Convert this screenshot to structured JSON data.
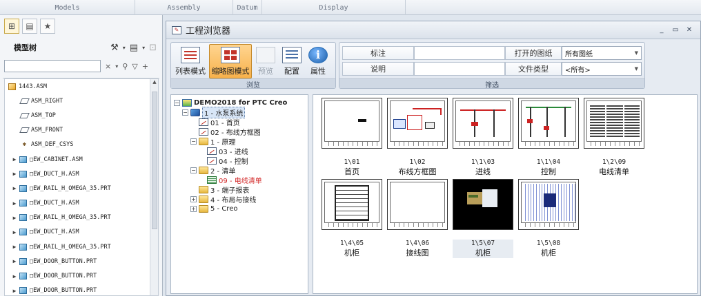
{
  "top_ribbon": {
    "groups": [
      "Models",
      "Assembly",
      "Datum",
      "Display"
    ]
  },
  "left_panel": {
    "title": "模型树",
    "search_value": "",
    "tree": [
      {
        "label": "1443.ASM",
        "type": "root"
      },
      {
        "label": "ASM_RIGHT",
        "type": "plane"
      },
      {
        "label": "ASM_TOP",
        "type": "plane"
      },
      {
        "label": "ASM_FRONT",
        "type": "plane"
      },
      {
        "label": "ASM_DEF_CSYS",
        "type": "csys"
      },
      {
        "label": "□EW_CABINET.ASM",
        "type": "part"
      },
      {
        "label": "□EW_DUCT_H.ASM",
        "type": "part"
      },
      {
        "label": "□EW_RAIL_H_OMEGA_35.PRT",
        "type": "part"
      },
      {
        "label": "□EW_DUCT_H.ASM",
        "type": "part"
      },
      {
        "label": "□EW_RAIL_H_OMEGA_35.PRT",
        "type": "part"
      },
      {
        "label": "□EW_DUCT_H.ASM",
        "type": "part"
      },
      {
        "label": "□EW_RAIL_H_OMEGA_35.PRT",
        "type": "part"
      },
      {
        "label": "□EW_DOOR_BUTTON.PRT",
        "type": "part"
      },
      {
        "label": "□EW_DOOR_BUTTON.PRT",
        "type": "part"
      },
      {
        "label": "□EW_DOOR_BUTTON.PRT",
        "type": "part"
      }
    ]
  },
  "browser": {
    "title": "工程浏览器",
    "toolbar": {
      "browse_group": "浏览",
      "filter_group": "筛选",
      "buttons": {
        "list_mode": "列表模式",
        "thumb_mode": "缩略图模式",
        "preview": "预览",
        "config": "配置",
        "properties": "属性"
      },
      "filter": {
        "annotation_label": "标注",
        "annotation_value": "",
        "open_drawings_label": "打开的图纸",
        "open_drawings_value": "所有图纸",
        "desc_label": "说明",
        "desc_value": "",
        "file_type_label": "文件类型",
        "file_type_value": "<所有>"
      }
    },
    "tree": {
      "project": "DEMO2018 for PTC Creo",
      "system": "1 - 水泵系统",
      "n01": "01 - 首页",
      "n02": "02 - 布线方框图",
      "f1": "1 - 原理",
      "n03": "03 - 进线",
      "n04": "04 - 控制",
      "f2": "2 - 清单",
      "n09": "09 - 电线清单",
      "f3": "3 - 端子报表",
      "f4": "4 - 布局与接线",
      "f5": "5 - Creo"
    },
    "thumbnails": [
      {
        "code": "1\\01",
        "name": "首页"
      },
      {
        "code": "1\\02",
        "name": "布线方框图"
      },
      {
        "code": "1\\1\\03",
        "name": "进线"
      },
      {
        "code": "1\\1\\04",
        "name": "控制"
      },
      {
        "code": "1\\2\\09",
        "name": "电线清单"
      },
      {
        "code": "1\\4\\05",
        "name": "机柜"
      },
      {
        "code": "1\\4\\06",
        "name": "接线图"
      },
      {
        "code": "1\\5\\07",
        "name": "机柜"
      },
      {
        "code": "1\\5\\08",
        "name": "机柜"
      }
    ]
  }
}
